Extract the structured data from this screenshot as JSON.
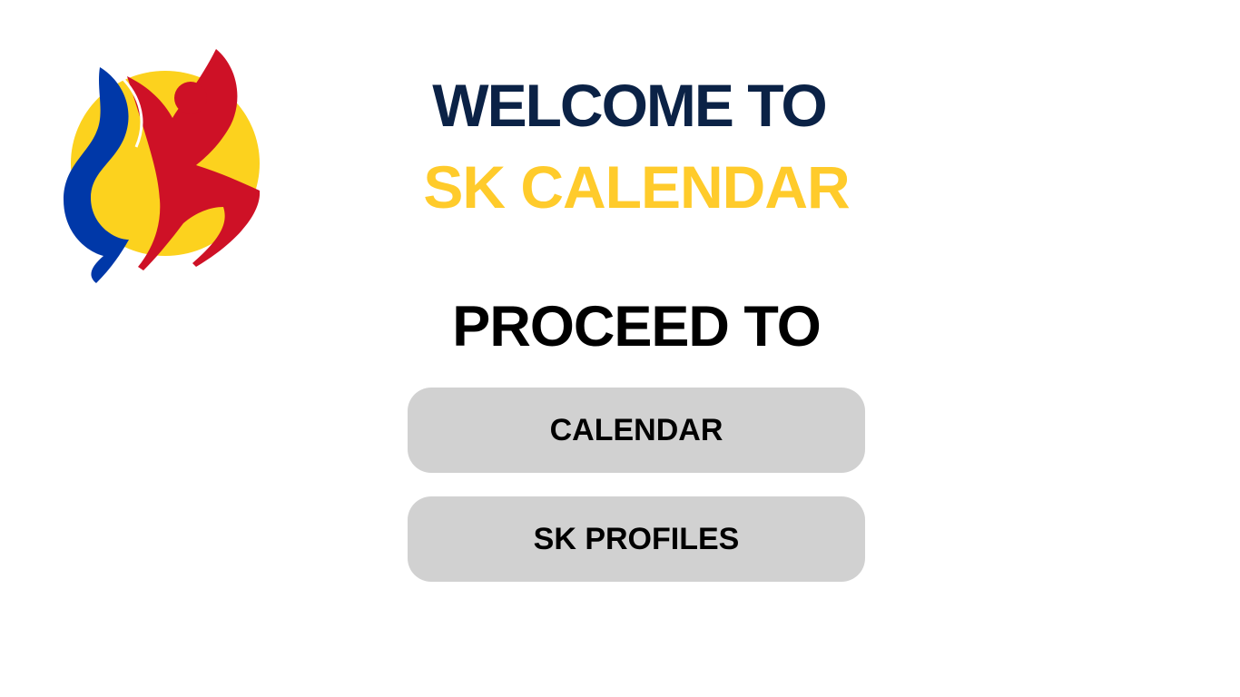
{
  "logo": {
    "name": "sk-logo",
    "colors": {
      "sun": "#FCD21E",
      "blue_figure": "#0038A8",
      "red_figure": "#CE1126"
    }
  },
  "welcome": {
    "line1": "WELCOME TO",
    "line2": "SK CALENDAR"
  },
  "proceed": {
    "label": "PROCEED TO"
  },
  "buttons": {
    "calendar": "CALENDAR",
    "sk_profiles": "SK PROFILES"
  },
  "colors": {
    "navy": "#0B2246",
    "yellow": "#FFCB2B",
    "black": "#000000",
    "button_bg": "#D1D1D1"
  }
}
